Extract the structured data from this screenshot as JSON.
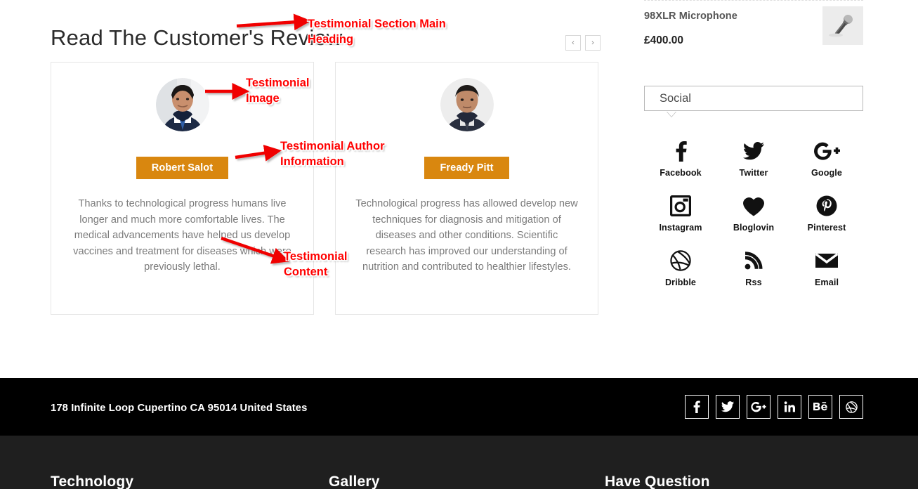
{
  "testimonial_section": {
    "heading": "Read The Customer's Review",
    "nav": {
      "prev_label": "‹",
      "next_label": "›"
    },
    "cards": [
      {
        "author": "Robert Salot",
        "text": "Thanks to technological progress humans live longer and much more comfortable lives. The medical advancements have helped us develop vaccines and treatment for diseases which were previously lethal.",
        "avatar_icon": "avatar-photo-robert-salot"
      },
      {
        "author": "Fready Pitt",
        "text": "Technological progress has allowed develop new techniques for diagnosis and mitigation of diseases and other conditions. Scientific research has improved our understanding of nutrition and contributed to healthier lifestyles.",
        "avatar_icon": "avatar-photo-fready-pitt"
      }
    ]
  },
  "sidebar": {
    "product": {
      "name": "98XLR Microphone",
      "price": "£400.00",
      "thumb_icon": "microphone-icon"
    },
    "social_widget": {
      "title": "Social",
      "items": [
        {
          "label": "Facebook",
          "icon": "facebook-icon"
        },
        {
          "label": "Twitter",
          "icon": "twitter-icon"
        },
        {
          "label": "Google",
          "icon": "google-plus-icon"
        },
        {
          "label": "Instagram",
          "icon": "instagram-icon"
        },
        {
          "label": "Bloglovin",
          "icon": "heart-icon"
        },
        {
          "label": "Pinterest",
          "icon": "pinterest-icon"
        },
        {
          "label": "Dribble",
          "icon": "dribbble-icon"
        },
        {
          "label": "Rss",
          "icon": "rss-icon"
        },
        {
          "label": "Email",
          "icon": "envelope-icon"
        }
      ]
    }
  },
  "footer": {
    "address": "178 Infinite Loop Cupertino CA 95014 United States",
    "socials": [
      {
        "label": "f",
        "icon": "facebook-icon"
      },
      {
        "label": "t",
        "icon": "twitter-icon"
      },
      {
        "label": "G+",
        "icon": "google-plus-icon"
      },
      {
        "label": "in",
        "icon": "linkedin-icon"
      },
      {
        "label": "Bē",
        "icon": "behance-icon"
      },
      {
        "label": "d",
        "icon": "dribbble-icon"
      }
    ],
    "columns": [
      {
        "title": "Technology"
      },
      {
        "title": "Gallery"
      },
      {
        "title": "Have Question"
      }
    ]
  },
  "annotations": [
    {
      "text": "Testimonial Section Main\nHeading",
      "color": "#ff0000"
    },
    {
      "text": "Testimonial\nImage",
      "color": "#ff0000"
    },
    {
      "text": "Testimonial Author\nInformation",
      "color": "#ff0000"
    },
    {
      "text": "Testimonial\nContent",
      "color": "#ff0000"
    }
  ]
}
